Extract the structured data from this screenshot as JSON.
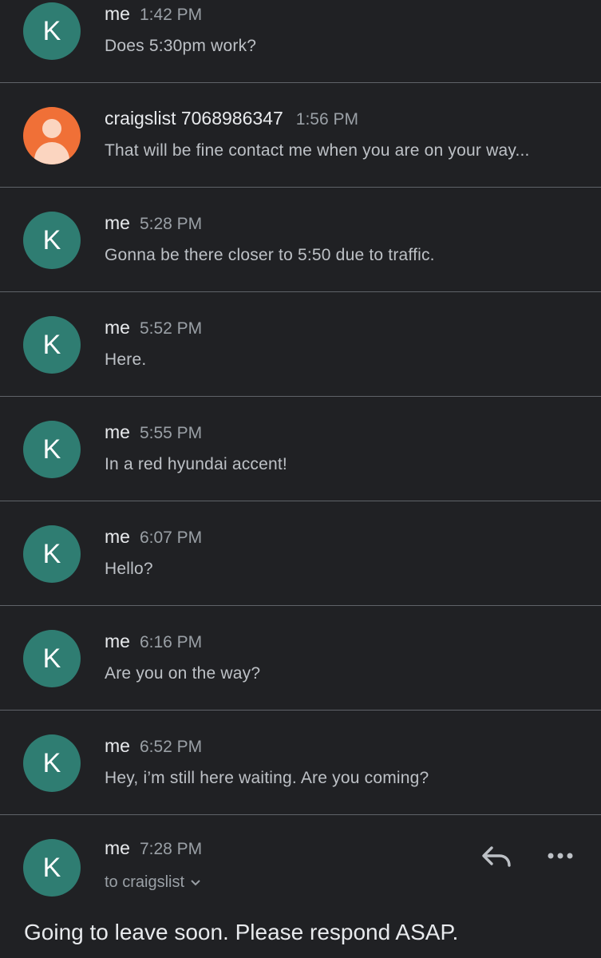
{
  "colors": {
    "background": "#202124",
    "divider": "#5f6368",
    "avatar_teal": "#2f7d72",
    "avatar_orange": "#f07037"
  },
  "messages": [
    {
      "sender": "me",
      "time": "1:42 PM",
      "snippet": "Does 5:30pm work?",
      "avatar_letter": "K"
    },
    {
      "sender": "craigslist 7068986347",
      "time": "1:56 PM",
      "snippet": "That will be fine contact me when you are on your way...",
      "avatar_icon": "person-icon"
    },
    {
      "sender": "me",
      "time": "5:28 PM",
      "snippet": "Gonna be there closer to 5:50 due to traffic.",
      "avatar_letter": "K"
    },
    {
      "sender": "me",
      "time": "5:52 PM",
      "snippet": "Here.",
      "avatar_letter": "K"
    },
    {
      "sender": "me",
      "time": "5:55 PM",
      "snippet": "In a red hyundai accent!",
      "avatar_letter": "K"
    },
    {
      "sender": "me",
      "time": "6:07 PM",
      "snippet": "Hello?",
      "avatar_letter": "K"
    },
    {
      "sender": "me",
      "time": "6:16 PM",
      "snippet": "Are you on the way?",
      "avatar_letter": "K"
    },
    {
      "sender": "me",
      "time": "6:52 PM",
      "snippet": "Hey, i’m still here waiting. Are you coming?",
      "avatar_letter": "K"
    }
  ],
  "expanded": {
    "sender": "me",
    "time": "7:28 PM",
    "avatar_letter": "K",
    "to": "to craigslist",
    "body": "Going to leave soon. Please respond ASAP.",
    "actions": [
      "reply-icon",
      "more-options-icon"
    ]
  }
}
